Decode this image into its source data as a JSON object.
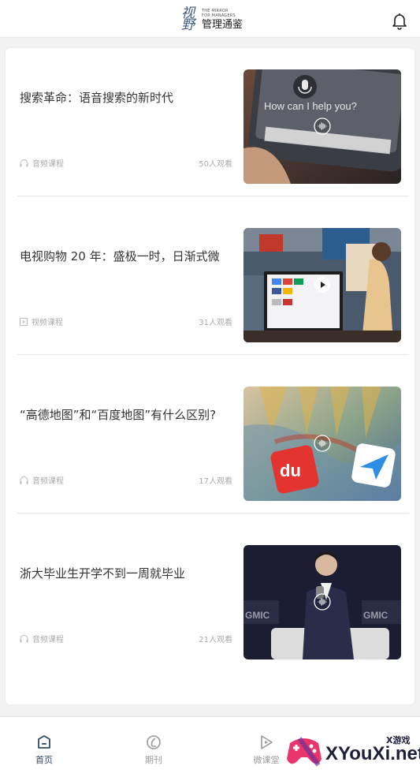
{
  "header": {
    "logo_script": "视野",
    "logo_small_1": "THE MIRROR",
    "logo_small_2": "FOR MANAGERS",
    "logo_main": "管理通鉴"
  },
  "articles": [
    {
      "title": "搜索革命：语音搜索的新时代",
      "type": "音频课程",
      "type_icon": "headphones-icon",
      "views": "50人观看",
      "badge": "audio-wave-icon"
    },
    {
      "title": "电视购物 20 年：盛极一时，日渐式微",
      "type": "视频课程",
      "type_icon": "video-icon",
      "views": "31人观看",
      "badge": "play-icon"
    },
    {
      "title": "“高德地图”和“百度地图”有什么区别?",
      "type": "音频课程",
      "type_icon": "headphones-icon",
      "views": "17人观看",
      "badge": "audio-wave-icon"
    },
    {
      "title": "浙大毕业生开学不到一周就毕业",
      "type": "音频课程",
      "type_icon": "headphones-icon",
      "views": "21人观看",
      "badge": "audio-wave-icon"
    }
  ],
  "thumb_text": {
    "voice_prompt": "How can I help you?",
    "baidu_logo": "du"
  },
  "tabs": [
    {
      "label": "首页",
      "icon": "home-icon",
      "active": true
    },
    {
      "label": "期刊",
      "icon": "journal-icon",
      "active": false
    },
    {
      "label": "微课堂",
      "icon": "play-course-icon",
      "active": false
    }
  ],
  "watermark": {
    "main": "XYouXi.net",
    "small": "X游戏"
  },
  "colors": {
    "active_tab": "#2f4a66",
    "inactive": "#999999",
    "meta_text": "#aaaaaa"
  }
}
